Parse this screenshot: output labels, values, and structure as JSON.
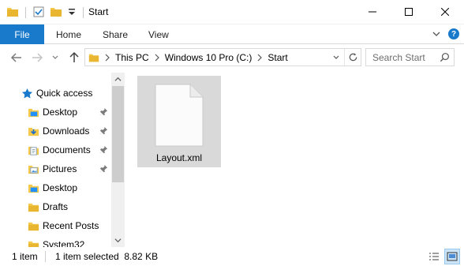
{
  "window": {
    "title": "Start",
    "controls": {
      "minimize": "minimize",
      "maximize": "maximize",
      "close": "close"
    }
  },
  "ribbon": {
    "tabs": [
      {
        "label": "File"
      },
      {
        "label": "Home"
      },
      {
        "label": "Share"
      },
      {
        "label": "View"
      }
    ],
    "help": "?"
  },
  "address": {
    "crumbs": [
      "This PC",
      "Windows 10 Pro (C:)",
      "Start"
    ]
  },
  "search": {
    "placeholder": "Search Start"
  },
  "navpane": {
    "items": [
      {
        "label": "Quick access",
        "icon": "star-icon",
        "pinned": false
      },
      {
        "label": "Desktop",
        "icon": "desktop-folder-icon",
        "pinned": true
      },
      {
        "label": "Downloads",
        "icon": "downloads-folder-icon",
        "pinned": true
      },
      {
        "label": "Documents",
        "icon": "documents-folder-icon",
        "pinned": true
      },
      {
        "label": "Pictures",
        "icon": "pictures-folder-icon",
        "pinned": true
      },
      {
        "label": "Desktop",
        "icon": "desktop-folder-icon",
        "pinned": false
      },
      {
        "label": "Drafts",
        "icon": "folder-icon",
        "pinned": false
      },
      {
        "label": "Recent Posts",
        "icon": "folder-icon",
        "pinned": false
      },
      {
        "label": "System32",
        "icon": "folder-icon",
        "pinned": false
      }
    ]
  },
  "files": [
    {
      "name": "Layout.xml",
      "icon": "document-icon",
      "selected": true
    }
  ],
  "status": {
    "item_count": "1 item",
    "selection": "1 item selected  8.82 KB"
  },
  "colors": {
    "accent": "#1979ca",
    "folder": "#f5c94c",
    "selection": "#d9d9d9"
  }
}
